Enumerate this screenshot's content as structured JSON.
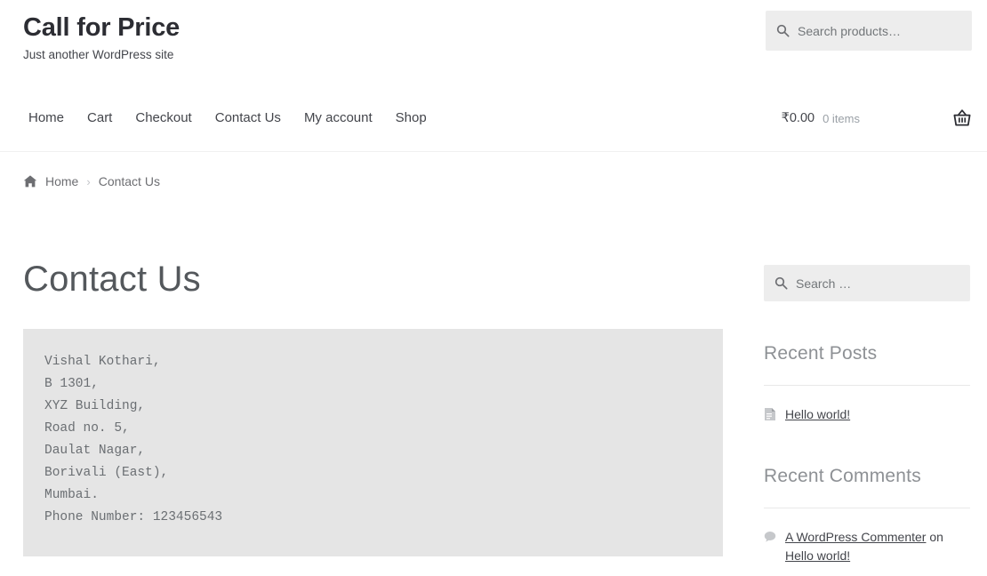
{
  "site": {
    "title": "Call for Price",
    "tagline": "Just another WordPress site"
  },
  "header": {
    "product_search": {
      "placeholder": "Search products…",
      "value": "",
      "icon": "search-icon"
    },
    "nav": [
      {
        "label": "Home"
      },
      {
        "label": "Cart"
      },
      {
        "label": "Checkout"
      },
      {
        "label": "Contact Us"
      },
      {
        "label": "My account"
      },
      {
        "label": "Shop"
      }
    ],
    "cart": {
      "amount": "₹0.00",
      "count": "0 items",
      "icon": "shopping-basket-icon"
    }
  },
  "breadcrumb": {
    "home_icon": "home-icon",
    "home": "Home",
    "separator": "›",
    "current": "Contact Us"
  },
  "main": {
    "title": "Contact Us",
    "address_block": "Vishal Kothari,\nB 1301,\nXYZ Building,\nRoad no. 5,\nDaulat Nagar,\nBorivali (East),\nMumbai.\nPhone Number: 123456543"
  },
  "sidebar": {
    "search": {
      "placeholder": "Search …",
      "value": "",
      "icon": "search-icon"
    },
    "recent_posts": {
      "title": "Recent Posts",
      "items": [
        {
          "icon": "document-icon",
          "label": "Hello world!"
        }
      ]
    },
    "recent_comments": {
      "title": "Recent Comments",
      "items": [
        {
          "icon": "comment-icon",
          "author": "A WordPress Commenter",
          "connector": " on ",
          "post": "Hello world!"
        }
      ]
    }
  },
  "colors": {
    "text": "#43454b",
    "muted": "#6d6e72",
    "heading": "#54585c",
    "widget_heading": "#8e9195",
    "field_bg": "#ededed",
    "pre_bg": "#e5e5e5",
    "rule": "#e8e8e8"
  }
}
